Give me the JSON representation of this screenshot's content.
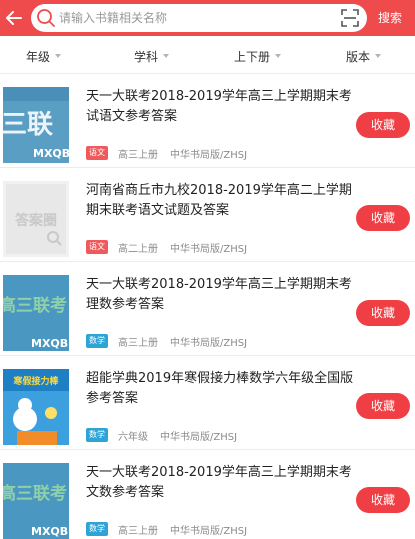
{
  "search": {
    "placeholder": "请输入书籍相关名称",
    "button_label": "搜索"
  },
  "filters": [
    "年级",
    "学科",
    "上下册",
    "版本"
  ],
  "items": [
    {
      "title": "天一大联考2018-2019学年高三上学期期末考试语文参考答案",
      "subject": "语文",
      "grade": "高三上册",
      "publisher": "中华书局版/ZHSJ",
      "button": "收藏",
      "cover_text": "三联",
      "cover_sub": "MXQB"
    },
    {
      "title": "河南省商丘市九校2018-2019学年高二上学期期末联考语文试题及答案",
      "subject": "语文",
      "grade": "高二上册",
      "publisher": "中华书局版/ZHSJ",
      "button": "收藏",
      "cover_text": "答案圈"
    },
    {
      "title": "天一大联考2018-2019学年高三上学期期末考理数参考答案",
      "subject": "数学",
      "grade": "高三上册",
      "publisher": "中华书局版/ZHSJ",
      "button": "收藏",
      "cover_text": "高三联考",
      "cover_sub": "MXQB"
    },
    {
      "title": "超能学典2019年寒假接力棒数学六年级全国版参考答案",
      "subject": "数学",
      "grade": "六年级",
      "publisher": "中华书局版/ZHSJ",
      "button": "收藏",
      "cover_text": "寒假接力棒"
    },
    {
      "title": "天一大联考2018-2019学年高三上学期期末考文数参考答案",
      "subject": "数学",
      "grade": "高三上册",
      "publisher": "中华书局版/ZHSJ",
      "button": "收藏",
      "cover_text": "高三联考",
      "cover_sub": "MXQB"
    }
  ],
  "colors": {
    "brand_red": "#ef4a4c",
    "tag_chinese": "#ef5b5d",
    "tag_math": "#2ea3d6"
  }
}
